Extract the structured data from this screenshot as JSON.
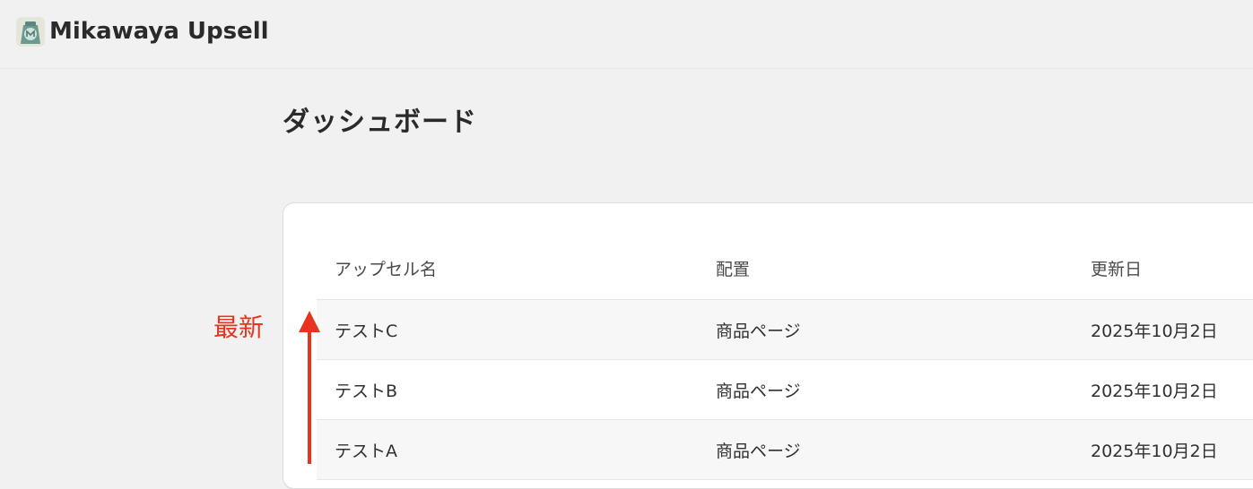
{
  "header": {
    "app_name": "Mikawaya Upsell",
    "logo_icon": "mikawaya-logo-icon"
  },
  "page": {
    "title": "ダッシュボード"
  },
  "table": {
    "columns": [
      "アップセル名",
      "配置",
      "更新日"
    ],
    "rows": [
      {
        "name": "テストC",
        "placement": "商品ページ",
        "updated": "2025年10月2日"
      },
      {
        "name": "テストB",
        "placement": "商品ページ",
        "updated": "2025年10月2日"
      },
      {
        "name": "テストA",
        "placement": "商品ページ",
        "updated": "2025年10月2日"
      }
    ]
  },
  "annotation": {
    "label": "最新",
    "color": "#e8341c",
    "icon": "arrow-up-icon"
  },
  "colors": {
    "background": "#f1f1f1",
    "card": "#ffffff",
    "accent_red": "#e8341c"
  }
}
